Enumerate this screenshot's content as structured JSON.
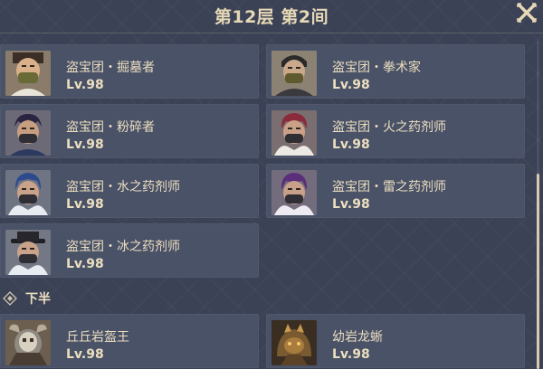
{
  "header": {
    "title": "第12层 第2间"
  },
  "upper_enemies": [
    {
      "name": "盗宝团・掘墓者",
      "level": "Lv.98",
      "icon": "treasure-hoarder-digger"
    },
    {
      "name": "盗宝团・拳术家",
      "level": "Lv.98",
      "icon": "treasure-hoarder-pugilist"
    },
    {
      "name": "盗宝团・粉碎者",
      "level": "Lv.98",
      "icon": "treasure-hoarder-crusher"
    },
    {
      "name": "盗宝团・火之药剂师",
      "level": "Lv.98",
      "icon": "treasure-hoarder-pyro-potioneer"
    },
    {
      "name": "盗宝团・水之药剂师",
      "level": "Lv.98",
      "icon": "treasure-hoarder-hydro-potioneer"
    },
    {
      "name": "盗宝团・雷之药剂师",
      "level": "Lv.98",
      "icon": "treasure-hoarder-electro-potioneer"
    },
    {
      "name": "盗宝团・冰之药剂师",
      "level": "Lv.98",
      "icon": "treasure-hoarder-cryo-potioneer"
    }
  ],
  "lower_section": {
    "label": "下半",
    "enemies": [
      {
        "name": "丘丘岩盔王",
        "level": "Lv.98",
        "icon": "mitachurl-rock-shieldwall"
      },
      {
        "name": "幼岩龙蜥",
        "level": "Lv.98",
        "icon": "geovishap-hatchling"
      }
    ]
  },
  "colors": {
    "background": "#3b4256",
    "card": "#4a5268",
    "text": "#ecdfbf",
    "title": "#e6d8b6"
  }
}
